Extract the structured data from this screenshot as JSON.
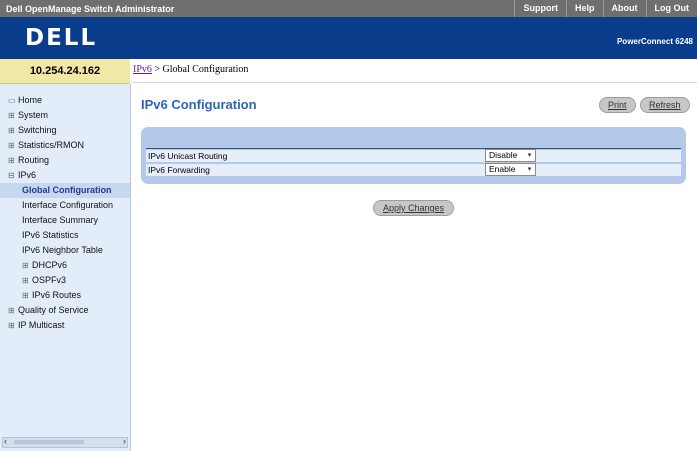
{
  "topbar": {
    "title": "Dell OpenManage Switch Administrator",
    "links": [
      "Support",
      "Help",
      "About",
      "Log Out"
    ]
  },
  "header": {
    "logo_text": "DELL",
    "product": "PowerConnect 6248"
  },
  "ip_address": "10.254.24.162",
  "sidebar": {
    "items": [
      {
        "label": "Home",
        "icon": "home-icon"
      },
      {
        "label": "System",
        "icon": "expand-plus-icon"
      },
      {
        "label": "Switching",
        "icon": "expand-plus-icon"
      },
      {
        "label": "Statistics/RMON",
        "icon": "expand-plus-icon"
      },
      {
        "label": "Routing",
        "icon": "expand-plus-icon"
      },
      {
        "label": "IPv6",
        "icon": "collapse-minus-icon"
      },
      {
        "label": "Global Configuration",
        "selected": true
      },
      {
        "label": "Interface Configuration"
      },
      {
        "label": "Interface Summary"
      },
      {
        "label": "IPv6 Statistics"
      },
      {
        "label": "IPv6 Neighbor Table"
      },
      {
        "label": "DHCPv6",
        "icon": "expand-plus-icon"
      },
      {
        "label": "OSPFv3",
        "icon": "expand-plus-icon"
      },
      {
        "label": "IPv6 Routes",
        "icon": "expand-plus-icon"
      },
      {
        "label": "Quality of Service",
        "icon": "expand-plus-icon"
      },
      {
        "label": "IP Multicast",
        "icon": "expand-plus-icon"
      }
    ]
  },
  "breadcrumb": {
    "link": "IPv6",
    "separator": ">",
    "current": "Global Configuration"
  },
  "page": {
    "title": "IPv6 Configuration",
    "print_label": "Print",
    "refresh_label": "Refresh",
    "apply_label": "Apply Changes"
  },
  "config": {
    "rows": [
      {
        "label": "IPv6 Unicast Routing",
        "value": "Disable"
      },
      {
        "label": "IPv6 Forwarding",
        "value": "Enable"
      }
    ]
  },
  "colors": {
    "topbar": "#6f6f6f",
    "header": "#0a3c8c",
    "ip_box": "#f1e7a6",
    "sidebar": "#e3edf9",
    "panel": "#b4c9ea",
    "title": "#2a66b5"
  }
}
